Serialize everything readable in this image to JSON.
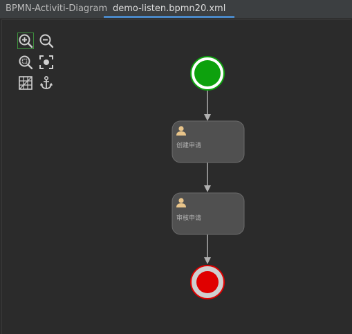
{
  "tabs": [
    {
      "label": "BPMN-Activiti-Diagram"
    },
    {
      "label": "demo-listen.bpmn20.xml",
      "active": true
    }
  ],
  "toolbar": {
    "buttons": [
      {
        "name": "zoom-in",
        "icon": "zoom-in-icon"
      },
      {
        "name": "zoom-out",
        "icon": "zoom-out-icon"
      },
      {
        "name": "zoom-fit",
        "icon": "zoom-fit-icon"
      },
      {
        "name": "focus",
        "icon": "focus-icon"
      },
      {
        "name": "grid",
        "icon": "grid-icon"
      },
      {
        "name": "anchor",
        "icon": "anchor-icon"
      }
    ]
  },
  "diagram": {
    "start_event": {
      "type": "start-event",
      "color": "#0da10d"
    },
    "tasks": [
      {
        "label": "创建申请",
        "icon": "user-icon"
      },
      {
        "label": "审核申请",
        "icon": "user-icon"
      }
    ],
    "end_event": {
      "type": "end-event",
      "color": "#e00000"
    }
  },
  "colors": {
    "background": "#2b2b2b",
    "tab_bar": "#3c3f41",
    "active_tab_underline": "#4a88c7",
    "task_fill": "#505050",
    "flow_line": "#b0b0b0",
    "user_icon": "#e8c48a"
  }
}
